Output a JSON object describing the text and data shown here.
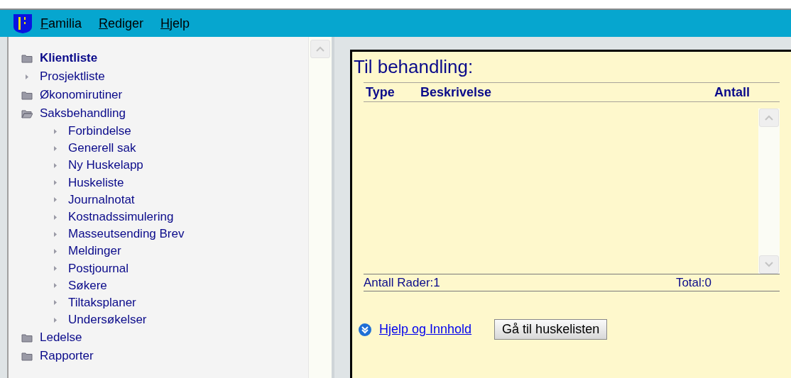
{
  "menu": [
    {
      "label": "Familia"
    },
    {
      "label": "Rediger"
    },
    {
      "label": "Hjelp"
    }
  ],
  "tree": [
    {
      "label": "Klientliste",
      "kind": "folder",
      "selected": true,
      "expanded": false
    },
    {
      "label": "Prosjektliste",
      "kind": "leaf",
      "selected": false
    },
    {
      "label": "Økonomirutiner",
      "kind": "folder",
      "selected": false,
      "expanded": false
    },
    {
      "label": "Saksbehandling",
      "kind": "folder",
      "selected": false,
      "expanded": true,
      "children": [
        {
          "label": "Forbindelse",
          "selected": false
        },
        {
          "label": "Generell sak",
          "selected": false
        },
        {
          "label": "Ny Huskelapp",
          "selected": false
        },
        {
          "label": "Huskeliste",
          "selected": false
        },
        {
          "label": "Journalnotat",
          "selected": false
        },
        {
          "label": "Kostnadssimulering",
          "selected": false
        },
        {
          "label": "Masseutsending Brev",
          "selected": false
        },
        {
          "label": "Meldinger",
          "selected": false
        },
        {
          "label": "Postjournal",
          "selected": false
        },
        {
          "label": "Søkere",
          "selected": false
        },
        {
          "label": "Tiltaksplaner",
          "selected": false
        },
        {
          "label": "Undersøkelser",
          "selected": false
        }
      ]
    },
    {
      "label": "Ledelse",
      "kind": "folder",
      "selected": false,
      "expanded": false
    },
    {
      "label": "Rapporter",
      "kind": "folder",
      "selected": false,
      "expanded": false
    }
  ],
  "panel": {
    "title": "Til behandling:",
    "table": {
      "columns": [
        "Type",
        "Beskrivelse",
        "Antall"
      ]
    },
    "footer": {
      "rows": "Antall Rader:1",
      "total": "Total:0"
    },
    "help_link": "Hjelp og Innhold",
    "button": "Gå til huskelisten"
  }
}
